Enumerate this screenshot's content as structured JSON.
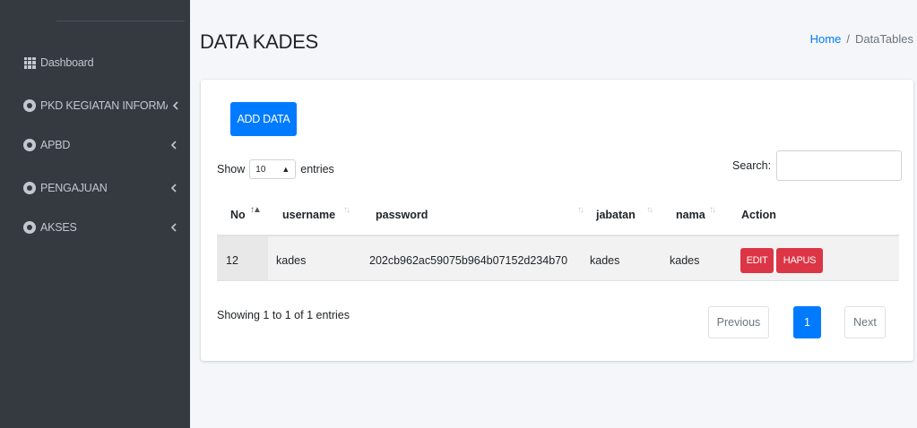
{
  "sidebar": {
    "items": [
      {
        "label": "Dashboard",
        "icon": "grid-icon",
        "has_chevron": false
      },
      {
        "label": "PKD KEGIATAN INFORMASI",
        "icon": "circle-icon",
        "has_chevron": true
      },
      {
        "label": "APBD",
        "icon": "circle-icon",
        "has_chevron": true
      },
      {
        "label": "PENGAJUAN",
        "icon": "circle-icon",
        "has_chevron": true
      },
      {
        "label": "AKSES",
        "icon": "circle-icon",
        "has_chevron": true
      }
    ]
  },
  "header": {
    "title": "DATA KADES",
    "breadcrumb": {
      "home": "Home",
      "separator": "/",
      "current": "DataTables"
    }
  },
  "card": {
    "add_button": "ADD DATA",
    "show_label": "Show",
    "entries_value": "10",
    "entries_label": "entries",
    "search_label": "Search:",
    "search_value": "",
    "columns": [
      "No",
      "username",
      "password",
      "jabatan",
      "nama",
      "Action"
    ],
    "rows": [
      {
        "no": "12",
        "username": "kades",
        "password": "202cb962ac59075b964b07152d234b70",
        "jabatan": "kades",
        "nama": "kades",
        "edit": "EDIT",
        "delete": "HAPUS"
      }
    ],
    "info": "Showing 1 to 1 of 1 entries",
    "pagination": {
      "previous": "Previous",
      "current_page": "1",
      "next": "Next"
    }
  },
  "colors": {
    "sidebar_bg": "#343a40",
    "primary": "#007bff",
    "danger": "#dc3545",
    "page_bg": "#f4f6f9"
  }
}
